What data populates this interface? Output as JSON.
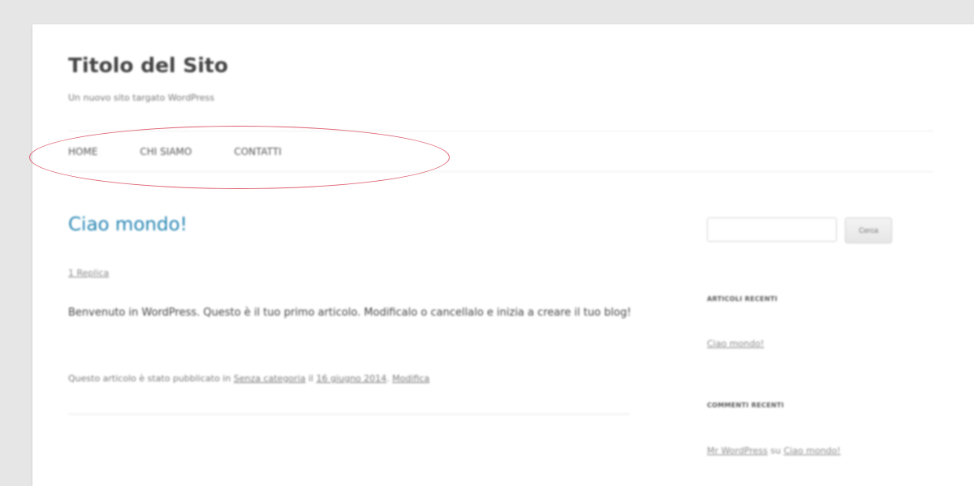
{
  "header": {
    "site_title": "Titolo del Sito",
    "tagline": "Un nuovo sito targato WordPress"
  },
  "nav": {
    "items": [
      {
        "label": "HOME"
      },
      {
        "label": "CHI SIAMO"
      },
      {
        "label": "CONTATTI"
      }
    ]
  },
  "post": {
    "title": "Ciao mondo!",
    "reply_link": "1 Replica",
    "body": "Benvenuto in WordPress. Questo è il tuo primo articolo. Modificalo o cancellalo e inizia a creare il tuo blog!",
    "meta": {
      "prefix": "Questo articolo è stato pubblicato in ",
      "category": "Senza categoria",
      "date_prefix": " il ",
      "date": "16 giugno 2014",
      "separator": ". ",
      "edit": "Modifica"
    }
  },
  "sidebar": {
    "search": {
      "placeholder": "",
      "button_label": "Cerca"
    },
    "recent_posts": {
      "title": "ARTICOLI RECENTI",
      "items": [
        {
          "label": "Ciao mondo!"
        }
      ]
    },
    "recent_comments": {
      "title": "COMMENTI RECENTI",
      "author": "Mr WordPress",
      "connector": " su ",
      "post": "Ciao mondo!"
    }
  },
  "annotation": {
    "color": "#dd6070"
  },
  "colors": {
    "background": "#e6e6e6",
    "page": "#ffffff",
    "post_title": "#2585b3"
  }
}
